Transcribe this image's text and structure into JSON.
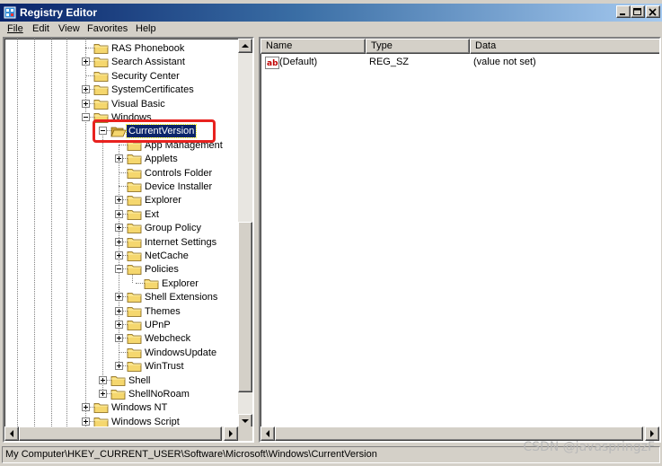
{
  "window": {
    "title": "Registry Editor",
    "controls": {
      "minimize_icon": "minimize-icon",
      "maximize_icon": "maximize-icon",
      "close_icon": "close-icon"
    }
  },
  "menubar": {
    "items": [
      {
        "label": "File"
      },
      {
        "label": "Edit"
      },
      {
        "label": "View"
      },
      {
        "label": "Favorites"
      },
      {
        "label": "Help"
      }
    ]
  },
  "tree": {
    "nodes": [
      {
        "label": "RAS Phonebook",
        "depth": 0,
        "expander": "none"
      },
      {
        "label": "Search Assistant",
        "depth": 0,
        "expander": "plus"
      },
      {
        "label": "Security Center",
        "depth": 0,
        "expander": "none"
      },
      {
        "label": "SystemCertificates",
        "depth": 0,
        "expander": "plus"
      },
      {
        "label": "Visual Basic",
        "depth": 0,
        "expander": "plus"
      },
      {
        "label": "Windows",
        "depth": 0,
        "expander": "minus"
      },
      {
        "label": "CurrentVersion",
        "depth": 1,
        "expander": "minus",
        "selected": true,
        "open": true
      },
      {
        "label": "App Management",
        "depth": 2,
        "expander": "none"
      },
      {
        "label": "Applets",
        "depth": 2,
        "expander": "plus"
      },
      {
        "label": "Controls Folder",
        "depth": 2,
        "expander": "none"
      },
      {
        "label": "Device Installer",
        "depth": 2,
        "expander": "none"
      },
      {
        "label": "Explorer",
        "depth": 2,
        "expander": "plus"
      },
      {
        "label": "Ext",
        "depth": 2,
        "expander": "plus"
      },
      {
        "label": "Group Policy",
        "depth": 2,
        "expander": "plus"
      },
      {
        "label": "Internet Settings",
        "depth": 2,
        "expander": "plus"
      },
      {
        "label": "NetCache",
        "depth": 2,
        "expander": "plus"
      },
      {
        "label": "Policies",
        "depth": 2,
        "expander": "minus"
      },
      {
        "label": "Explorer",
        "depth": 3,
        "expander": "none"
      },
      {
        "label": "Shell Extensions",
        "depth": 2,
        "expander": "plus"
      },
      {
        "label": "Themes",
        "depth": 2,
        "expander": "plus"
      },
      {
        "label": "UPnP",
        "depth": 2,
        "expander": "plus"
      },
      {
        "label": "Webcheck",
        "depth": 2,
        "expander": "plus"
      },
      {
        "label": "WindowsUpdate",
        "depth": 2,
        "expander": "none"
      },
      {
        "label": "WinTrust",
        "depth": 2,
        "expander": "plus"
      },
      {
        "label": "Shell",
        "depth": 1,
        "expander": "plus"
      },
      {
        "label": "ShellNoRoam",
        "depth": 1,
        "expander": "plus"
      },
      {
        "label": "Windows NT",
        "depth": 0,
        "expander": "plus"
      },
      {
        "label": "Windows Script",
        "depth": 0,
        "expander": "plus"
      }
    ]
  },
  "list": {
    "columns": [
      {
        "label": "Name"
      },
      {
        "label": "Type"
      },
      {
        "label": "Data"
      }
    ],
    "rows": [
      {
        "name": "(Default)",
        "type": "REG_SZ",
        "data": "(value not set)",
        "icon": "string-value-icon"
      }
    ]
  },
  "statusbar": {
    "path": "My Computer\\HKEY_CURRENT_USER\\Software\\Microsoft\\Windows\\CurrentVersion"
  },
  "watermark": {
    "text": "CSDN @javaspringzF"
  },
  "colors": {
    "title_start": "#0a246a",
    "title_end": "#a6caf0",
    "selection": "#0a246a",
    "annotation_red": "#e8221f",
    "folder_yellow": "#f5d76e"
  }
}
